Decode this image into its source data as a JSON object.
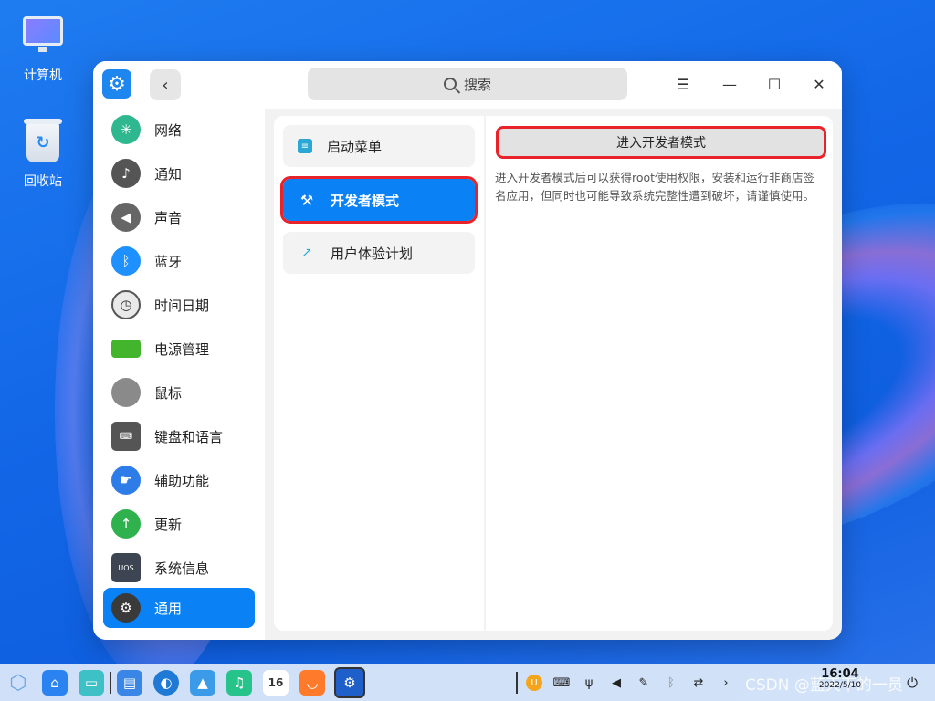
{
  "desktop": {
    "icons": [
      {
        "label": "计算机",
        "icon": "computer-icon"
      },
      {
        "label": "回收站",
        "icon": "trash-icon"
      }
    ]
  },
  "window": {
    "search_placeholder": "搜索",
    "sidebar": [
      {
        "label": "网络",
        "icon": "network-icon",
        "color": "#2fb88f"
      },
      {
        "label": "通知",
        "icon": "bell-icon",
        "color": "#555555"
      },
      {
        "label": "声音",
        "icon": "speaker-icon",
        "color": "#666666"
      },
      {
        "label": "蓝牙",
        "icon": "bluetooth-icon",
        "color": "#1e90ff"
      },
      {
        "label": "时间日期",
        "icon": "clock-icon",
        "color": "#e9e9e9"
      },
      {
        "label": "电源管理",
        "icon": "battery-icon",
        "color": "#43b52c"
      },
      {
        "label": "鼠标",
        "icon": "mouse-icon",
        "color": "#8a8a8a"
      },
      {
        "label": "键盘和语言",
        "icon": "keyboard-icon",
        "color": "#555555"
      },
      {
        "label": "辅助功能",
        "icon": "accessibility-icon",
        "color": "#2e7ce8"
      },
      {
        "label": "更新",
        "icon": "update-icon",
        "color": "#2fb14d"
      },
      {
        "label": "系统信息",
        "icon": "system-info-icon",
        "color": "#3d4552"
      },
      {
        "label": "通用",
        "icon": "gear-icon",
        "color": "#3a3a3a",
        "active": true
      }
    ],
    "middle": [
      {
        "label": "启动菜单",
        "icon": "boot-menu-icon"
      },
      {
        "label": "开发者模式",
        "icon": "tools-icon",
        "active": true
      },
      {
        "label": "用户体验计划",
        "icon": "chart-line-icon"
      }
    ],
    "right": {
      "button_label": "进入开发者模式",
      "description": "进入开发者模式后可以获得root使用权限，安装和运行非商店签名应用，但同时也可能导致系统完整性遭到破坏，请谨慎使用。"
    }
  },
  "taskbar": {
    "clock_time": "16:04",
    "clock_date": "2022/5/10",
    "calendar_day": "16",
    "watermark": "CSDN @蓝天下的一员"
  }
}
